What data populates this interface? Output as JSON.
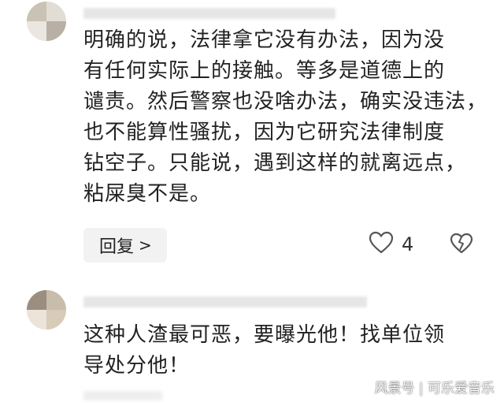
{
  "comment1": {
    "lines": [
      "明确的说，法律拿它没有办法，因为没",
      "有任何实际上的接触。等多是道德上的",
      "谴责。然后警察也没啥办法，确实没违法，",
      "也不能算性骚扰，因为它研究法律制度",
      "钻空子。只能说，遇到这样的就离远点，",
      "粘屎臭不是。"
    ],
    "reply_label": "回复",
    "reply_chevron": ">",
    "like_count": "4",
    "like_icon": "heart-outline-icon",
    "dislike_icon": "broken-heart-icon"
  },
  "comment2": {
    "lines": [
      "这种人渣最可恶，要曝光他！找单位领",
      "导处分他！"
    ]
  },
  "watermark": "风景号 | 可乐爱音乐",
  "colors": {
    "text": "#222222",
    "reply_bg": "#f2f2f2",
    "icon": "#555555"
  }
}
